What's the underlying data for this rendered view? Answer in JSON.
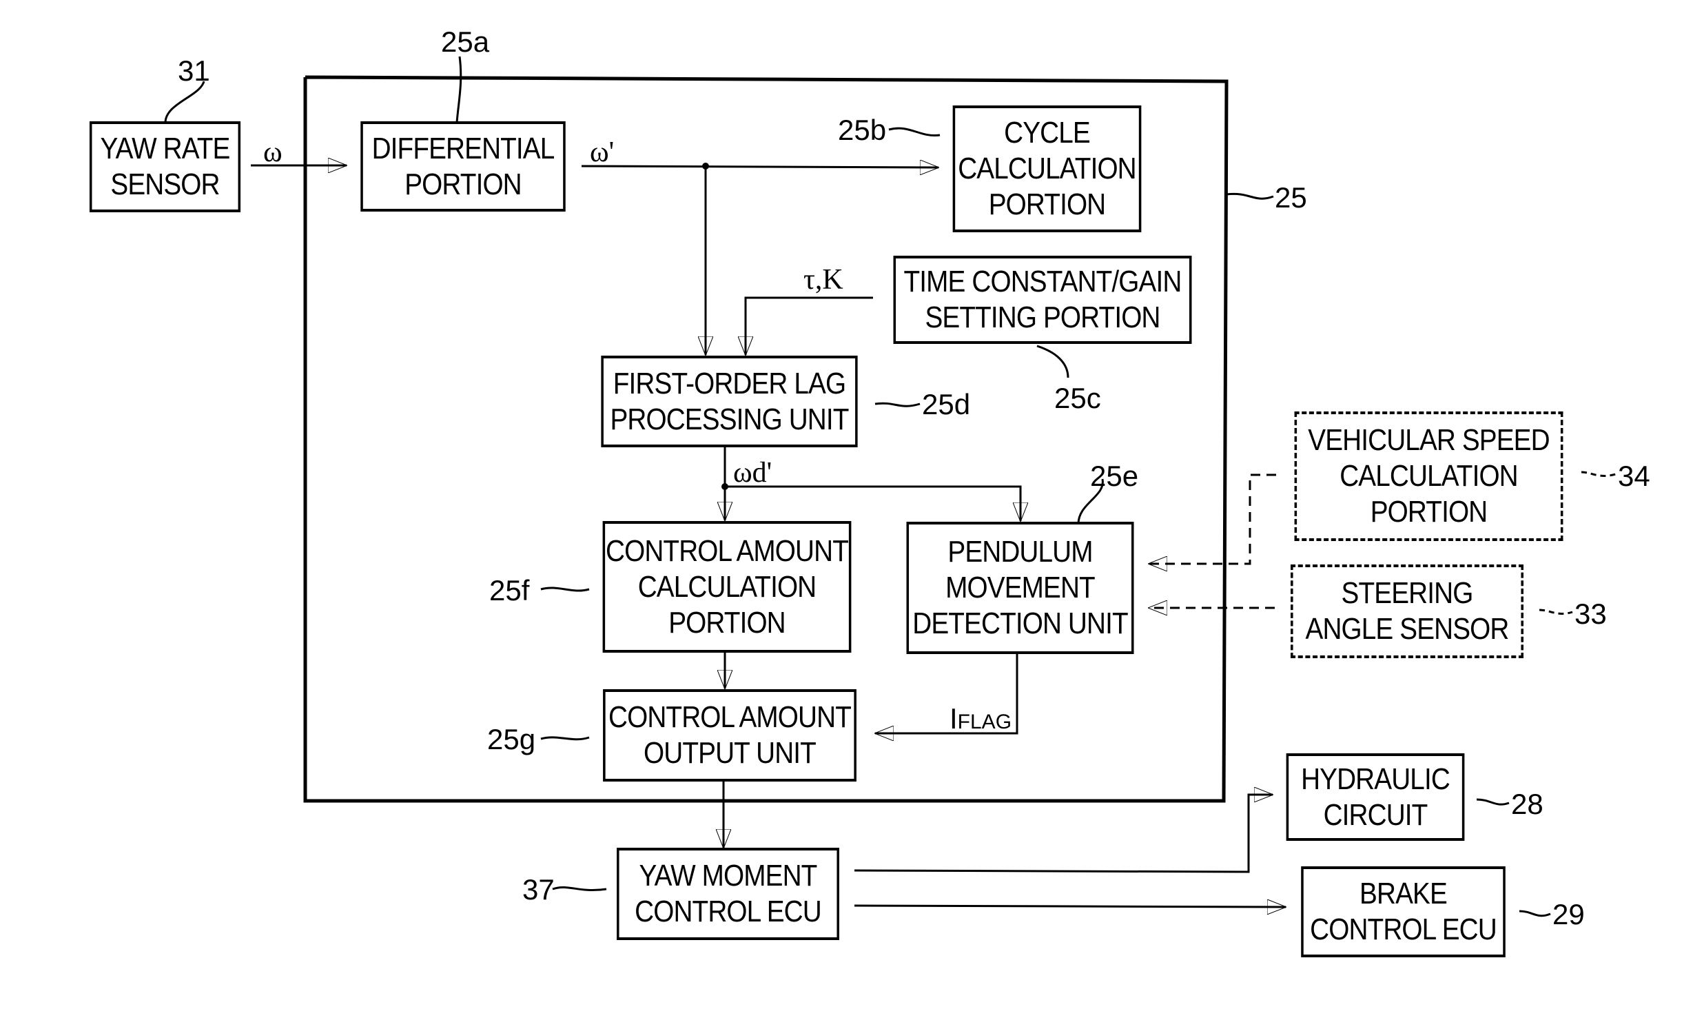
{
  "figure": {
    "outer_frame_ref": "25",
    "blocks": {
      "yaw_rate_sensor": {
        "ref": "31",
        "lines": [
          "YAW RATE",
          "SENSOR"
        ]
      },
      "differential": {
        "ref": "25a",
        "lines": [
          "DIFFERENTIAL",
          "PORTION"
        ]
      },
      "cycle_calc": {
        "ref": "25b",
        "lines": [
          "CYCLE",
          "CALCULATION",
          "PORTION"
        ]
      },
      "time_constant": {
        "ref": "25c",
        "lines": [
          "TIME CONSTANT/GAIN",
          "SETTING PORTION"
        ]
      },
      "first_order_lag": {
        "ref": "25d",
        "lines": [
          "FIRST-ORDER LAG",
          "PROCESSING UNIT"
        ]
      },
      "pendulum": {
        "ref": "25e",
        "lines": [
          "PENDULUM",
          "MOVEMENT",
          "DETECTION UNIT"
        ]
      },
      "control_amount_calc": {
        "ref": "25f",
        "lines": [
          "CONTROL AMOUNT",
          "CALCULATION",
          "PORTION"
        ]
      },
      "control_amount_output": {
        "ref": "25g",
        "lines": [
          "CONTROL AMOUNT",
          "OUTPUT UNIT"
        ]
      },
      "vehicular_speed": {
        "ref": "34",
        "lines": [
          "VEHICULAR SPEED",
          "CALCULATION",
          "PORTION"
        ]
      },
      "steering_angle": {
        "ref": "33",
        "lines": [
          "STEERING",
          "ANGLE SENSOR"
        ]
      },
      "yaw_moment_ecu": {
        "ref": "37",
        "lines": [
          "YAW MOMENT",
          "CONTROL ECU"
        ]
      },
      "hydraulic": {
        "ref": "28",
        "lines": [
          "HYDRAULIC",
          "CIRCUIT"
        ]
      },
      "brake_ecu": {
        "ref": "29",
        "lines": [
          "BRAKE",
          "CONTROL ECU"
        ]
      }
    },
    "signals": {
      "omega": "ω",
      "omega_prime": "ω'",
      "tau_k": "τ,K",
      "omega_d_prime": "ωd'",
      "i_flag_main": "I",
      "i_flag_sub": "FLAG"
    }
  }
}
